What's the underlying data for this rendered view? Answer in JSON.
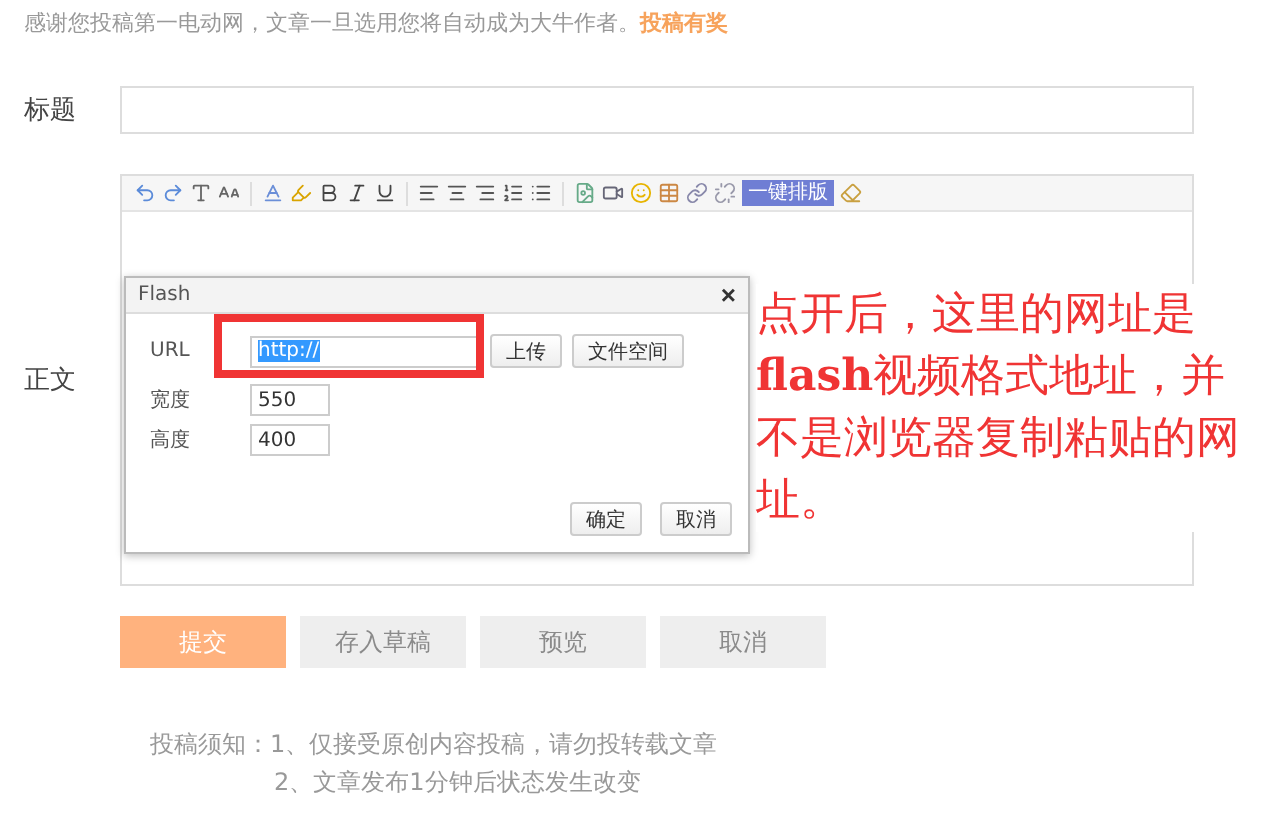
{
  "header": {
    "text": "感谢您投稿第一电动网，文章一旦选用您将自动成为大牛作者。",
    "link": "投稿有奖"
  },
  "title_field": {
    "label": "标题"
  },
  "editor": {
    "label": "正文",
    "toolbar_button": "一键排版"
  },
  "dialog": {
    "title": "Flash",
    "close": "×",
    "fields": [
      {
        "label": "URL",
        "value": "http://",
        "selected": true
      },
      {
        "label": "宽度",
        "value": "550",
        "selected": false
      },
      {
        "label": "高度",
        "value": "400",
        "selected": false
      }
    ],
    "url_buttons": [
      "上传",
      "文件空间"
    ],
    "buttons": [
      "确定",
      "取消"
    ]
  },
  "annotation": {
    "text": "点开后，这里的网址是**flash**视频格式地址，并不是浏览器复制粘贴的网址。"
  },
  "actions": [
    {
      "label": "提交",
      "primary": true
    },
    {
      "label": "存入草稿",
      "primary": false
    },
    {
      "label": "预览",
      "primary": false
    },
    {
      "label": "取消",
      "primary": false
    }
  ],
  "notes": [
    "投稿须知：1、仅接受原创内容投稿，请勿投转载文章",
    "2、文章发布1分钟后状态发生改变"
  ]
}
